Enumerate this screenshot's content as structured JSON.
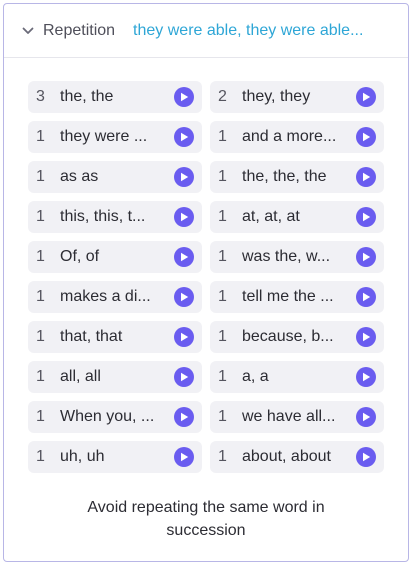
{
  "header": {
    "title": "Repetition",
    "summary": "they were able, they were able..."
  },
  "colors": {
    "accent": "#2ea6d6",
    "play": "#6a5cf0",
    "border": "#b8b6e6",
    "chip_bg": "#f1f1f5"
  },
  "icons": {
    "toggle": "chevron-down-icon",
    "play": "play-icon"
  },
  "items": [
    {
      "count": "3",
      "phrase": "the, the"
    },
    {
      "count": "2",
      "phrase": "they, they"
    },
    {
      "count": "1",
      "phrase": "they were ..."
    },
    {
      "count": "1",
      "phrase": "and a more..."
    },
    {
      "count": "1",
      "phrase": "as as"
    },
    {
      "count": "1",
      "phrase": "the, the, the"
    },
    {
      "count": "1",
      "phrase": "this, this, t..."
    },
    {
      "count": "1",
      "phrase": "at, at, at"
    },
    {
      "count": "1",
      "phrase": "Of, of"
    },
    {
      "count": "1",
      "phrase": "was the, w..."
    },
    {
      "count": "1",
      "phrase": "makes a di..."
    },
    {
      "count": "1",
      "phrase": "tell me the ..."
    },
    {
      "count": "1",
      "phrase": "that, that"
    },
    {
      "count": "1",
      "phrase": "because, b..."
    },
    {
      "count": "1",
      "phrase": "all, all"
    },
    {
      "count": "1",
      "phrase": "a, a"
    },
    {
      "count": "1",
      "phrase": "When you, ..."
    },
    {
      "count": "1",
      "phrase": "we have all..."
    },
    {
      "count": "1",
      "phrase": "uh, uh"
    },
    {
      "count": "1",
      "phrase": "about, about"
    }
  ],
  "footer": {
    "line1": "Avoid repeating the same word in",
    "line2": "succession"
  }
}
